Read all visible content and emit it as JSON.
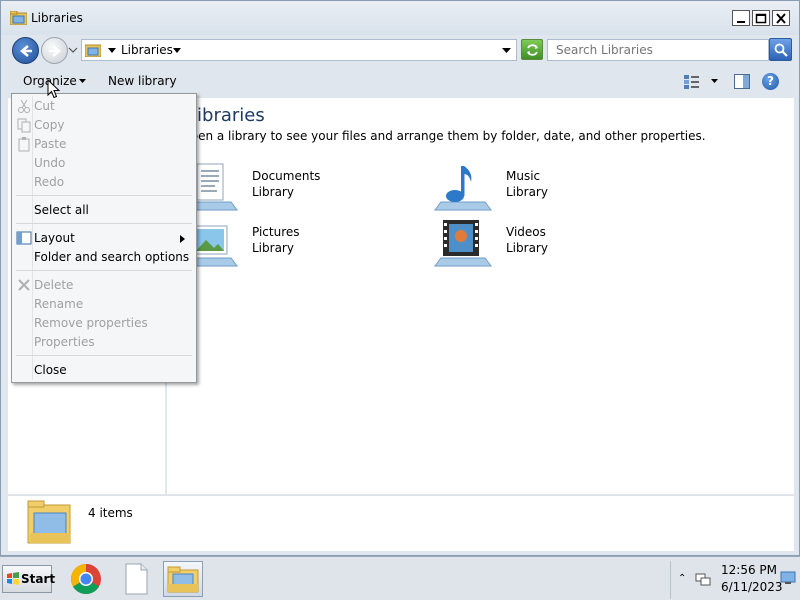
{
  "window": {
    "title": "Libraries",
    "address": {
      "path_segment": "Libraries"
    },
    "search": {
      "placeholder": "Search Libraries"
    },
    "toolbar": {
      "organize_label": "Organize",
      "new_library_label": "New library"
    }
  },
  "content": {
    "heading": "Libraries",
    "subtitle": "Open a library to see your files and arrange them by folder, date, and other properties.",
    "libraries": [
      {
        "name": "Documents",
        "kind": "Library",
        "icon": "documents-library-icon"
      },
      {
        "name": "Music",
        "kind": "Library",
        "icon": "music-library-icon"
      },
      {
        "name": "Pictures",
        "kind": "Library",
        "icon": "pictures-library-icon"
      },
      {
        "name": "Videos",
        "kind": "Library",
        "icon": "videos-library-icon"
      }
    ]
  },
  "details": {
    "item_count": "4 items"
  },
  "organize_menu": {
    "items": [
      {
        "label": "Cut",
        "enabled": false
      },
      {
        "label": "Copy",
        "enabled": false
      },
      {
        "label": "Paste",
        "enabled": false
      },
      {
        "label": "Undo",
        "enabled": false
      },
      {
        "label": "Redo",
        "enabled": false
      },
      {
        "label": "Select all",
        "enabled": true
      },
      {
        "label": "Layout",
        "enabled": true,
        "has_submenu": true
      },
      {
        "label": "Folder and search options",
        "enabled": true
      },
      {
        "label": "Delete",
        "enabled": false
      },
      {
        "label": "Rename",
        "enabled": false
      },
      {
        "label": "Remove properties",
        "enabled": false
      },
      {
        "label": "Properties",
        "enabled": false
      },
      {
        "label": "Close",
        "enabled": true
      }
    ]
  },
  "taskbar": {
    "start_label": "Start",
    "clock": {
      "time": "12:56 PM",
      "date": "6/11/2023"
    }
  }
}
